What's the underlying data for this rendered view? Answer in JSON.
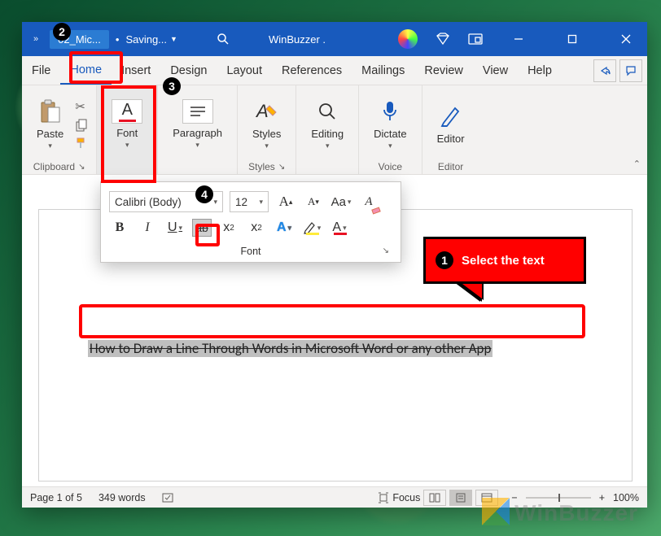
{
  "titlebar": {
    "doc_name": "02_Mic...",
    "status": "Saving...",
    "app_name": "WinBuzzer ."
  },
  "tabs": {
    "file": "File",
    "home": "Home",
    "insert": "Insert",
    "design": "Design",
    "layout": "Layout",
    "references": "References",
    "mailings": "Mailings",
    "review": "Review",
    "view": "View",
    "help": "Help"
  },
  "ribbon": {
    "paste": "Paste",
    "clipboard": "Clipboard",
    "font": "Font",
    "paragraph": "Paragraph",
    "styles": "Styles",
    "editing": "Editing",
    "dictate": "Dictate",
    "editor": "Editor",
    "voice": "Voice",
    "editor_grp": "Editor"
  },
  "font_popout": {
    "font_name": "Calibri (Body)",
    "font_size": "12",
    "increase": "A",
    "decrease": "A",
    "case": "Aa",
    "bold": "B",
    "italic": "I",
    "underline": "U",
    "strike": "ab",
    "sub_base": "x",
    "sub_sub": "2",
    "sup_base": "x",
    "sup_sup": "2",
    "texteff": "A",
    "hilite": "✎",
    "fcolor": "A",
    "group_label": "Font"
  },
  "document": {
    "text": "How to Draw a Line Through Words in Microsoft Word or any other App"
  },
  "callout": {
    "step1": "1",
    "text": "Select the text"
  },
  "steps": {
    "s2": "2",
    "s3": "3",
    "s4": "4"
  },
  "statusbar": {
    "page": "Page 1 of 5",
    "words": "349 words",
    "focus": "Focus",
    "zoom": "100%"
  },
  "watermark": "WinBuzzer"
}
